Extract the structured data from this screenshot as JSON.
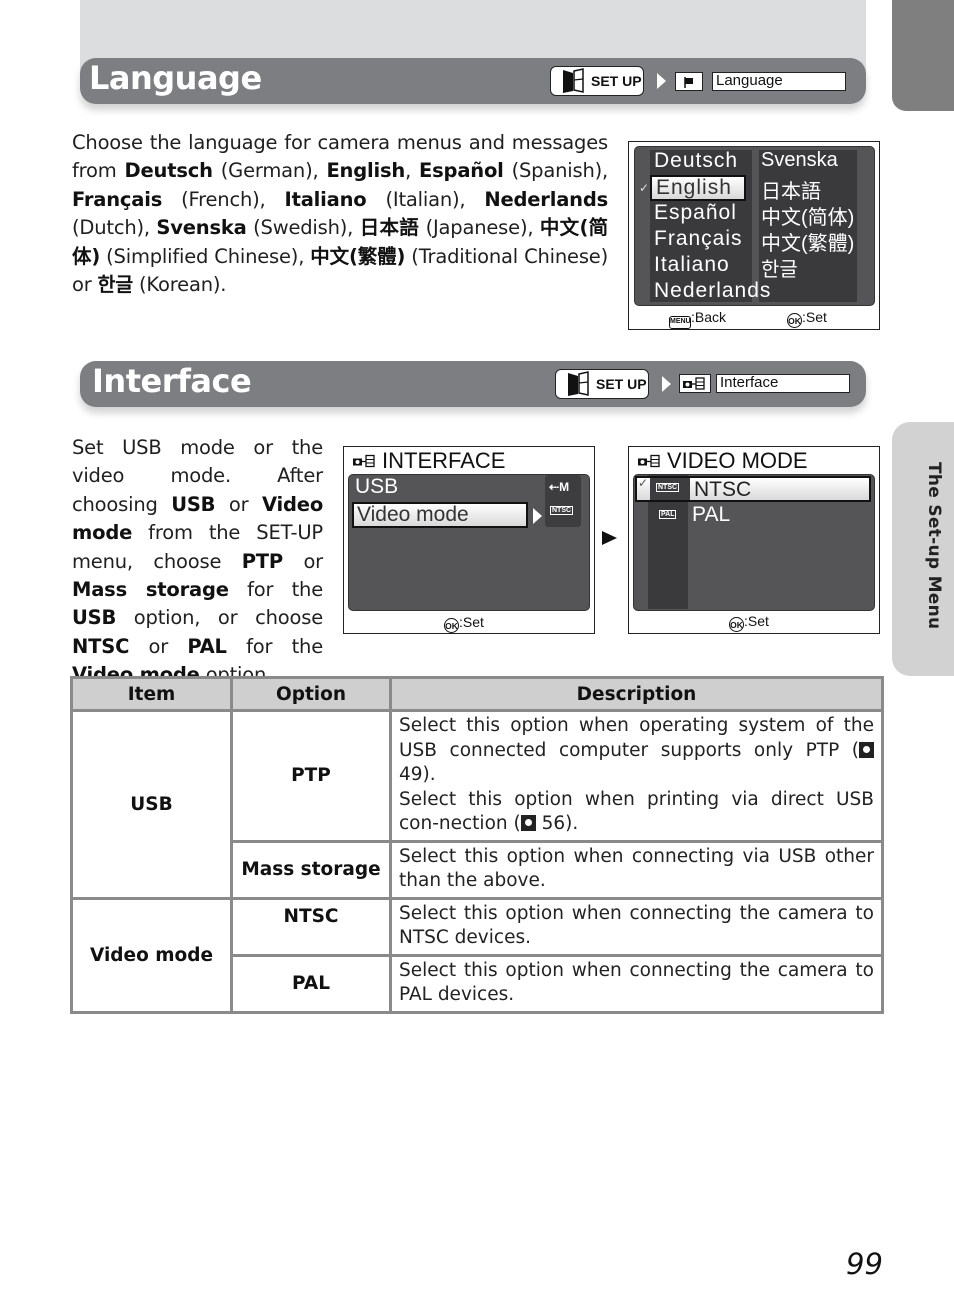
{
  "side_tab": {
    "label": "The Set-up Menu"
  },
  "language_section": {
    "title": "Language",
    "breadcrumb": {
      "menu": "SET UP",
      "icon": "flag-icon",
      "item": "Language"
    },
    "paragraph": [
      {
        "t": "Choose the language for camera menus and messages from ",
        "b": false
      },
      {
        "t": "Deutsch",
        "b": true
      },
      {
        "t": " (German), ",
        "b": false
      },
      {
        "t": "English",
        "b": true
      },
      {
        "t": ", ",
        "b": false
      },
      {
        "t": "Español",
        "b": true
      },
      {
        "t": " (Spanish), ",
        "b": false
      },
      {
        "t": "Français",
        "b": true
      },
      {
        "t": " (French), ",
        "b": false
      },
      {
        "t": "Italiano",
        "b": true
      },
      {
        "t": " (Italian), ",
        "b": false
      },
      {
        "t": "Nederlands",
        "b": true
      },
      {
        "t": " (Dutch), ",
        "b": false
      },
      {
        "t": "Svenska",
        "b": true
      },
      {
        "t": " (Swedish), ",
        "b": false
      },
      {
        "t": "日本語",
        "b": true
      },
      {
        "t": " (Japanese), ",
        "b": false
      },
      {
        "t": "中文(简体)",
        "b": true
      },
      {
        "t": " (Simplified Chinese), ",
        "b": false
      },
      {
        "t": "中文(繁體)",
        "b": true
      },
      {
        "t": " (Traditional Chinese) or ",
        "b": false
      },
      {
        "t": "한글",
        "b": true
      },
      {
        "t": " (Korean).",
        "b": false
      }
    ],
    "screen": {
      "left_column": [
        "Deutsch",
        "English",
        "Español",
        "Français",
        "Italiano",
        "Nederlands"
      ],
      "right_column": [
        "Svenska",
        "日本語",
        "中文(简体)",
        "中文(繁體)",
        "한글"
      ],
      "selected": "English",
      "footer_back": ":Back",
      "footer_set": ":Set",
      "menu_badge": "MENU",
      "ok_badge": "OK"
    }
  },
  "interface_section": {
    "title": "Interface",
    "breadcrumb": {
      "menu": "SET UP",
      "icon": "interface-icon",
      "item": "Interface"
    },
    "paragraph": [
      {
        "t": "Set USB mode or the video mode. After choosing ",
        "b": false
      },
      {
        "t": "USB",
        "b": true
      },
      {
        "t": " or ",
        "b": false
      },
      {
        "t": "Video mode",
        "b": true
      },
      {
        "t": " from the SET-UP menu, choose ",
        "b": false
      },
      {
        "t": "PTP",
        "b": true
      },
      {
        "t": " or ",
        "b": false
      },
      {
        "t": "Mass storage",
        "b": true
      },
      {
        "t": " for the ",
        "b": false
      },
      {
        "t": "USB",
        "b": true
      },
      {
        "t": " option, or choose ",
        "b": false
      },
      {
        "t": "NTSC",
        "b": true
      },
      {
        "t": " or ",
        "b": false
      },
      {
        "t": "PAL",
        "b": true
      },
      {
        "t": " for the ",
        "b": false
      },
      {
        "t": "Video mode",
        "b": true
      },
      {
        "t": " option.",
        "b": false
      }
    ],
    "screen1": {
      "title": "INTERFACE",
      "items": [
        "USB",
        "Video mode"
      ],
      "selected": "Video mode",
      "usb_value": "M",
      "video_value": "NTSC",
      "footer_set": ":Set",
      "ok_badge": "OK"
    },
    "screen2": {
      "title": "VIDEO MODE",
      "items": [
        {
          "badge": "NTSC",
          "label": "NTSC"
        },
        {
          "badge": "PAL",
          "label": "PAL"
        }
      ],
      "selected": "NTSC",
      "footer_set": ":Set",
      "ok_badge": "OK"
    }
  },
  "table": {
    "headers": [
      "Item",
      "Option",
      "Description"
    ],
    "rows": [
      {
        "item": "USB",
        "option": "PTP",
        "desc_a": "Select this option when operating system of the USB connected computer supports only PTP (",
        "ref1": " 49).",
        "desc_b": "Select this option when printing via direct USB con-nection (",
        "ref2": " 56)."
      },
      {
        "option": "Mass storage",
        "desc": "Select this option when connecting via USB other than the above."
      },
      {
        "item": "Video mode",
        "option": "NTSC",
        "desc": "Select this option when connecting the camera to NTSC devices."
      },
      {
        "option": "PAL",
        "desc": "Select this option when connecting the camera to PAL devices."
      }
    ]
  },
  "page_number": "99"
}
